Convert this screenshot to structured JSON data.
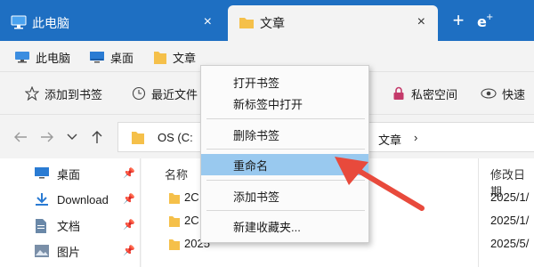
{
  "tabs": [
    {
      "label": "此电脑",
      "icon": "monitor-icon",
      "active": false
    },
    {
      "label": "文章",
      "icon": "folder-icon",
      "active": true
    }
  ],
  "tab_close": "×",
  "new_tab": "+",
  "bookmarks": [
    {
      "label": "此电脑",
      "icon": "monitor-icon"
    },
    {
      "label": "桌面",
      "icon": "desktop-icon"
    },
    {
      "label": "文章",
      "icon": "folder-icon"
    }
  ],
  "toolbar": {
    "add_bookmark": "添加到书签",
    "recent": "最近文件",
    "private_space": "私密空间",
    "quick": "快速"
  },
  "address": {
    "drive": "OS (C:",
    "folder": "文章",
    "sep": "›"
  },
  "sidebar": [
    {
      "label": "桌面",
      "icon": "desktop-icon"
    },
    {
      "label": "Download",
      "icon": "download-icon"
    },
    {
      "label": "文档",
      "icon": "document-icon"
    },
    {
      "label": "图片",
      "icon": "picture-icon"
    }
  ],
  "columns": {
    "name": "名称",
    "modified": "修改日期"
  },
  "rows": [
    {
      "name": "2C",
      "date": "2025/1/"
    },
    {
      "name": "2C",
      "date": "2025/1/"
    },
    {
      "name": "2025",
      "date": "2025/5/"
    }
  ],
  "context_menu": {
    "items": [
      "打开书签",
      "新标签中打开",
      "删除书签",
      "重命名",
      "添加书签",
      "新建收藏夹..."
    ],
    "highlighted": "重命名"
  },
  "colors": {
    "tab_bar": "#1e6fc2",
    "highlight": "#99c9ef",
    "arrow": "#e84a3c",
    "folder": "#f5c04a"
  }
}
